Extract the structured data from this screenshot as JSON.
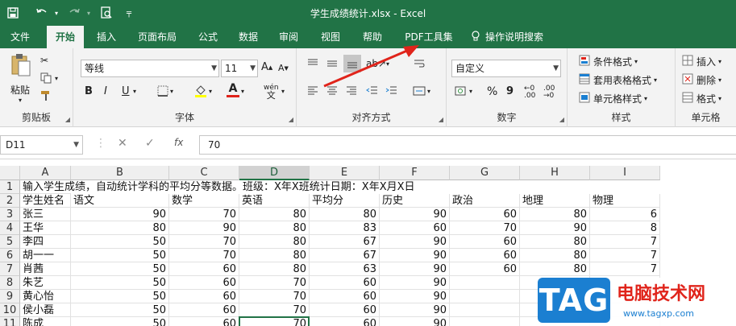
{
  "titlebar": {
    "title": "学生成绩统计.xlsx  -  Excel",
    "customize_glyph": "╤"
  },
  "menu": {
    "tabs": [
      "文件",
      "开始",
      "插入",
      "页面布局",
      "公式",
      "数据",
      "审阅",
      "视图",
      "帮助",
      "PDF工具集"
    ],
    "active": "开始",
    "tell_me": "操作说明搜索"
  },
  "ribbon": {
    "clipboard": {
      "label": "剪贴板",
      "paste": "粘贴"
    },
    "font": {
      "label": "字体",
      "name": "等线",
      "size": "11",
      "bold": "B",
      "italic": "I",
      "underline": "U",
      "font_color_glyph": "A",
      "phonetic": "wén"
    },
    "alignment": {
      "label": "对齐方式"
    },
    "number": {
      "label": "数字",
      "format": "自定义",
      "percent": "%",
      "comma": "9"
    },
    "styles": {
      "label": "样式",
      "cond_format": "条件格式",
      "table_format": "套用表格格式",
      "cell_styles": "单元格样式"
    },
    "cells": {
      "label": "单元格",
      "insert": "插入",
      "delete": "删除",
      "format": "格式"
    }
  },
  "formula_bar": {
    "name_box": "D11",
    "fx": "fx",
    "value": "70"
  },
  "sheet": {
    "columns": [
      "A",
      "B",
      "C",
      "D",
      "E",
      "F",
      "G",
      "H",
      "I"
    ],
    "selected_column": "D",
    "row_numbers": [
      "1",
      "2",
      "3",
      "4",
      "5",
      "6",
      "7",
      "8",
      "9",
      "10",
      "11"
    ],
    "title_row": "输入学生成绩，自动统计学科的平均分等数据。班级：X年X班统计日期：X年X月X日",
    "headers": [
      "学生姓名",
      "语文",
      "数学",
      "英语",
      "平均分",
      "历史",
      "政治",
      "地理",
      "物理"
    ],
    "rows": [
      [
        "张三",
        "90",
        "70",
        "80",
        "80",
        "90",
        "60",
        "80",
        "6"
      ],
      [
        "王华",
        "80",
        "90",
        "80",
        "83",
        "60",
        "70",
        "90",
        "8"
      ],
      [
        "李四",
        "50",
        "70",
        "80",
        "67",
        "90",
        "60",
        "80",
        "7"
      ],
      [
        "胡一一",
        "50",
        "70",
        "80",
        "67",
        "90",
        "60",
        "80",
        "7"
      ],
      [
        "肖茜",
        "50",
        "60",
        "80",
        "63",
        "90",
        "60",
        "80",
        "7"
      ],
      [
        "朱艺",
        "50",
        "60",
        "70",
        "60",
        "90",
        "",
        "",
        " "
      ],
      [
        "黄心怡",
        "50",
        "60",
        "70",
        "60",
        "90",
        "",
        "",
        ""
      ],
      [
        "侯小磊",
        "50",
        "60",
        "70",
        "60",
        "90",
        "",
        "",
        ""
      ],
      [
        "陈成",
        "50",
        "60",
        "70",
        "60",
        "90",
        "",
        "",
        ""
      ]
    ],
    "active_cell": "D11"
  },
  "watermark": {
    "tag": "TAG",
    "site_name": "电脑技术网",
    "url": "www.tagxp.com"
  },
  "colors": {
    "excel_green": "#217346",
    "arrow_red": "#e0241b",
    "tag_blue": "#1b7fd1"
  }
}
